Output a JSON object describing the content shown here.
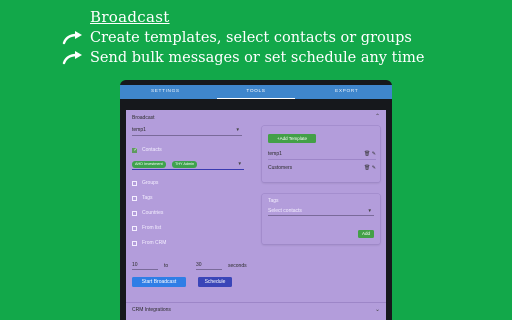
{
  "hero": {
    "title": "Broadcast",
    "line1": "Create templates, select contacts or groups",
    "line2": "Send bulk messages or set schedule any time"
  },
  "tabs": [
    {
      "label": "SETTINGS"
    },
    {
      "label": "TOOLS"
    },
    {
      "label": "EXPORT"
    }
  ],
  "broadcast": {
    "section_label": "Broadcast",
    "template_value": "temp1",
    "contacts_label": "Contacts",
    "chips": [
      "AHD Investment",
      "THY Admin"
    ],
    "options": [
      "Groups",
      "Tags",
      "Countries",
      "From list",
      "From CRM"
    ],
    "from_seconds": "10",
    "to_label": "to",
    "to_seconds": "30",
    "seconds_label": "seconds",
    "start_button": "Start Broadcast",
    "schedule_button": "Schedule"
  },
  "templates": {
    "add_button": "+Add Template",
    "items": [
      "temp1",
      "Customers"
    ]
  },
  "tags": {
    "label": "Tags",
    "placeholder": "Select contacts",
    "add_button": "Add"
  },
  "crm": {
    "label": "CRM Integrations"
  },
  "colors": {
    "background": "#12a84a",
    "tab_bar": "#3f86cc",
    "panel": "#b39ddb",
    "green_button": "#43a047",
    "blue_button": "#2f7ee6"
  }
}
